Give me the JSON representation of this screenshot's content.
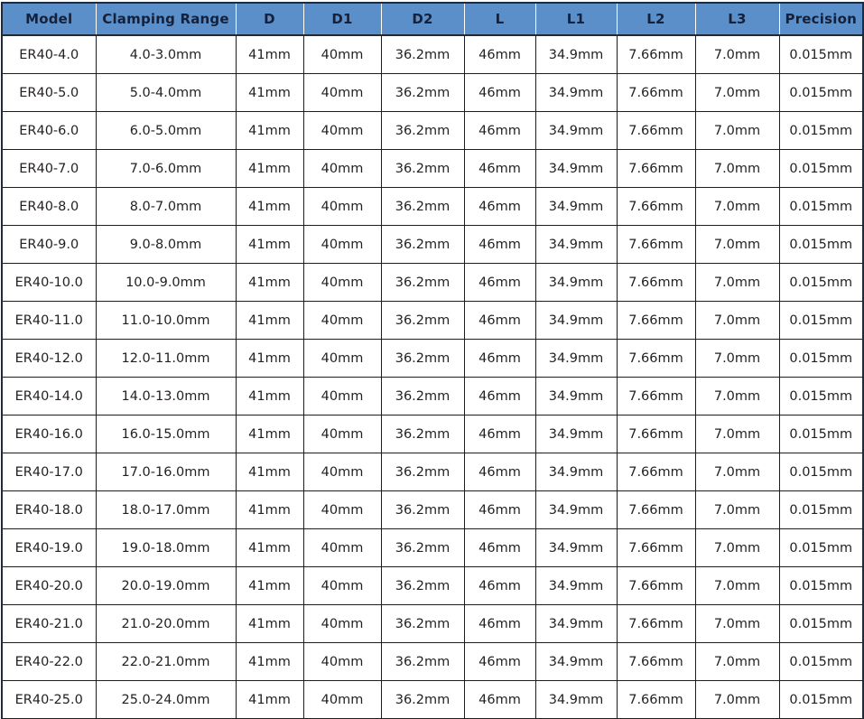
{
  "table": {
    "headers": [
      "Model",
      "Clamping Range",
      "D",
      "D1",
      "D2",
      "L",
      "L1",
      "L2",
      "L3",
      "Precision"
    ],
    "colors": {
      "header_background": "#5b8fc9",
      "header_text": "#15213a",
      "grid_line": "#1d1d1d",
      "outer_border": "#1f2a3a",
      "cell_background": "#ffffff",
      "cell_text": "#231f20"
    },
    "rows": [
      [
        "ER40-4.0",
        "4.0-3.0mm",
        "41mm",
        "40mm",
        "36.2mm",
        "46mm",
        "34.9mm",
        "7.66mm",
        "7.0mm",
        "0.015mm"
      ],
      [
        "ER40-5.0",
        "5.0-4.0mm",
        "41mm",
        "40mm",
        "36.2mm",
        "46mm",
        "34.9mm",
        "7.66mm",
        "7.0mm",
        "0.015mm"
      ],
      [
        "ER40-6.0",
        "6.0-5.0mm",
        "41mm",
        "40mm",
        "36.2mm",
        "46mm",
        "34.9mm",
        "7.66mm",
        "7.0mm",
        "0.015mm"
      ],
      [
        "ER40-7.0",
        "7.0-6.0mm",
        "41mm",
        "40mm",
        "36.2mm",
        "46mm",
        "34.9mm",
        "7.66mm",
        "7.0mm",
        "0.015mm"
      ],
      [
        "ER40-8.0",
        "8.0-7.0mm",
        "41mm",
        "40mm",
        "36.2mm",
        "46mm",
        "34.9mm",
        "7.66mm",
        "7.0mm",
        "0.015mm"
      ],
      [
        "ER40-9.0",
        "9.0-8.0mm",
        "41mm",
        "40mm",
        "36.2mm",
        "46mm",
        "34.9mm",
        "7.66mm",
        "7.0mm",
        "0.015mm"
      ],
      [
        "ER40-10.0",
        "10.0-9.0mm",
        "41mm",
        "40mm",
        "36.2mm",
        "46mm",
        "34.9mm",
        "7.66mm",
        "7.0mm",
        "0.015mm"
      ],
      [
        "ER40-11.0",
        "11.0-10.0mm",
        "41mm",
        "40mm",
        "36.2mm",
        "46mm",
        "34.9mm",
        "7.66mm",
        "7.0mm",
        "0.015mm"
      ],
      [
        "ER40-12.0",
        "12.0-11.0mm",
        "41mm",
        "40mm",
        "36.2mm",
        "46mm",
        "34.9mm",
        "7.66mm",
        "7.0mm",
        "0.015mm"
      ],
      [
        "ER40-14.0",
        "14.0-13.0mm",
        "41mm",
        "40mm",
        "36.2mm",
        "46mm",
        "34.9mm",
        "7.66mm",
        "7.0mm",
        "0.015mm"
      ],
      [
        "ER40-16.0",
        "16.0-15.0mm",
        "41mm",
        "40mm",
        "36.2mm",
        "46mm",
        "34.9mm",
        "7.66mm",
        "7.0mm",
        "0.015mm"
      ],
      [
        "ER40-17.0",
        "17.0-16.0mm",
        "41mm",
        "40mm",
        "36.2mm",
        "46mm",
        "34.9mm",
        "7.66mm",
        "7.0mm",
        "0.015mm"
      ],
      [
        "ER40-18.0",
        "18.0-17.0mm",
        "41mm",
        "40mm",
        "36.2mm",
        "46mm",
        "34.9mm",
        "7.66mm",
        "7.0mm",
        "0.015mm"
      ],
      [
        "ER40-19.0",
        "19.0-18.0mm",
        "41mm",
        "40mm",
        "36.2mm",
        "46mm",
        "34.9mm",
        "7.66mm",
        "7.0mm",
        "0.015mm"
      ],
      [
        "ER40-20.0",
        "20.0-19.0mm",
        "41mm",
        "40mm",
        "36.2mm",
        "46mm",
        "34.9mm",
        "7.66mm",
        "7.0mm",
        "0.015mm"
      ],
      [
        "ER40-21.0",
        "21.0-20.0mm",
        "41mm",
        "40mm",
        "36.2mm",
        "46mm",
        "34.9mm",
        "7.66mm",
        "7.0mm",
        "0.015mm"
      ],
      [
        "ER40-22.0",
        "22.0-21.0mm",
        "41mm",
        "40mm",
        "36.2mm",
        "46mm",
        "34.9mm",
        "7.66mm",
        "7.0mm",
        "0.015mm"
      ],
      [
        "ER40-25.0",
        "25.0-24.0mm",
        "41mm",
        "40mm",
        "36.2mm",
        "46mm",
        "34.9mm",
        "7.66mm",
        "7.0mm",
        "0.015mm"
      ]
    ]
  }
}
